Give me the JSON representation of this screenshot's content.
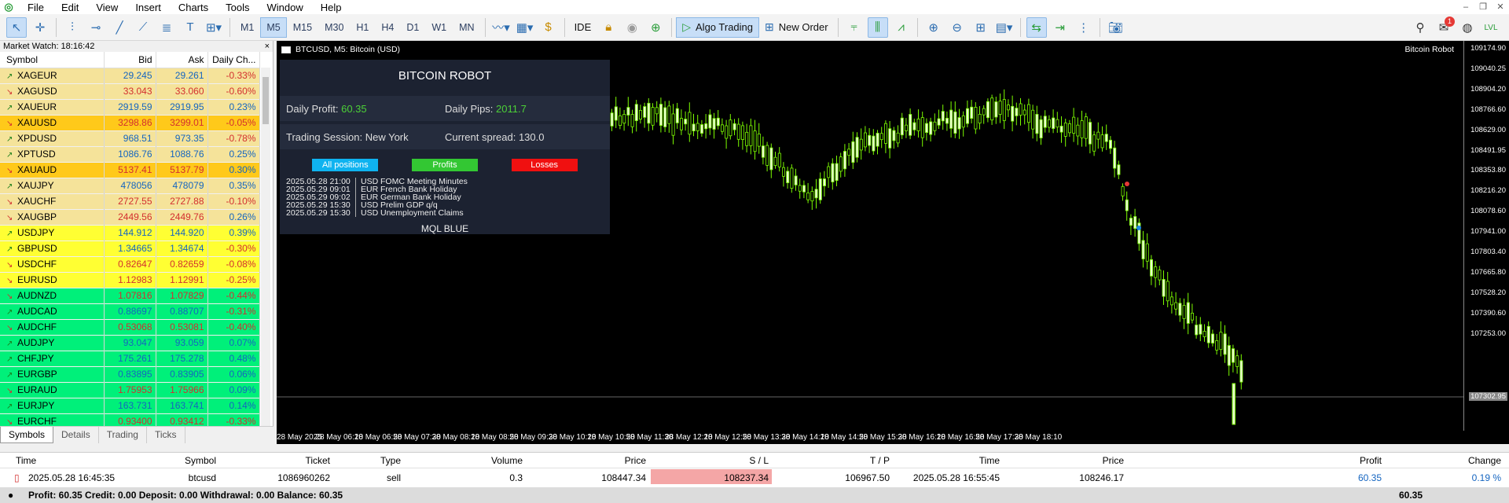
{
  "menu": [
    "File",
    "Edit",
    "View",
    "Insert",
    "Charts",
    "Tools",
    "Window",
    "Help"
  ],
  "toolbar": {
    "timeframes": [
      "M1",
      "M5",
      "M15",
      "M30",
      "H1",
      "H4",
      "D1",
      "W1",
      "MN"
    ],
    "active_tf": "M5",
    "ide": "IDE",
    "algo": "Algo Trading",
    "new_order": "New Order",
    "notif_count": "1",
    "lvl": "LVL"
  },
  "market_watch": {
    "title": "Market Watch: 18:16:42",
    "headers": [
      "Symbol",
      "Bid",
      "Ask",
      "Daily Ch..."
    ],
    "rows": [
      [
        "XAGEUR",
        "29.245",
        "29.261",
        "-0.33%",
        "up",
        "dn",
        "#f5e39a"
      ],
      [
        "XAGUSD",
        "33.043",
        "33.060",
        "-0.60%",
        "dn",
        "dn",
        "#f5e39a"
      ],
      [
        "XAUEUR",
        "2919.59",
        "2919.95",
        "0.23%",
        "up",
        "up",
        "#f5e39a"
      ],
      [
        "XAUUSD",
        "3298.86",
        "3299.01",
        "-0.05%",
        "dn",
        "dn",
        "#ffc91a"
      ],
      [
        "XPDUSD",
        "968.51",
        "973.35",
        "-0.78%",
        "up",
        "dn",
        "#f5e39a"
      ],
      [
        "XPTUSD",
        "1086.76",
        "1088.76",
        "0.25%",
        "up",
        "up",
        "#f5e39a"
      ],
      [
        "XAUAUD",
        "5137.41",
        "5137.79",
        "0.30%",
        "dn",
        "up",
        "#ffc91a"
      ],
      [
        "XAUJPY",
        "478056",
        "478079",
        "0.35%",
        "up",
        "up",
        "#f5e39a"
      ],
      [
        "XAUCHF",
        "2727.55",
        "2727.88",
        "-0.10%",
        "dn",
        "dn",
        "#f5e39a"
      ],
      [
        "XAUGBP",
        "2449.56",
        "2449.76",
        "0.26%",
        "dn",
        "up",
        "#f5e39a"
      ],
      [
        "USDJPY",
        "144.912",
        "144.920",
        "0.39%",
        "up",
        "up",
        "#ffff33"
      ],
      [
        "GBPUSD",
        "1.34665",
        "1.34674",
        "-0.30%",
        "up",
        "dn",
        "#ffff33"
      ],
      [
        "USDCHF",
        "0.82647",
        "0.82659",
        "-0.08%",
        "dn",
        "dn",
        "#ffff33"
      ],
      [
        "EURUSD",
        "1.12983",
        "1.12991",
        "-0.25%",
        "dn",
        "dn",
        "#ffff33"
      ],
      [
        "AUDNZD",
        "1.07816",
        "1.07829",
        "-0.44%",
        "dn",
        "dn",
        "#00f07a"
      ],
      [
        "AUDCAD",
        "0.88697",
        "0.88707",
        "-0.31%",
        "up",
        "dn",
        "#00f07a"
      ],
      [
        "AUDCHF",
        "0.53068",
        "0.53081",
        "-0.40%",
        "dn",
        "dn",
        "#00f07a"
      ],
      [
        "AUDJPY",
        "93.047",
        "93.059",
        "0.07%",
        "up",
        "up",
        "#00f07a"
      ],
      [
        "CHFJPY",
        "175.261",
        "175.278",
        "0.48%",
        "up",
        "up",
        "#00f07a"
      ],
      [
        "EURGBP",
        "0.83895",
        "0.83905",
        "0.06%",
        "up",
        "up",
        "#00f07a"
      ],
      [
        "EURAUD",
        "1.75953",
        "1.75966",
        "0.09%",
        "dn",
        "up",
        "#00f07a"
      ],
      [
        "EURJPY",
        "163.731",
        "163.741",
        "0.14%",
        "up",
        "up",
        "#00f07a"
      ],
      [
        "EURCHF",
        "0.93400",
        "0.93412",
        "-0.33%",
        "dn",
        "dn",
        "#00f07a"
      ]
    ],
    "tabs": [
      "Symbols",
      "Details",
      "Trading",
      "Ticks"
    ]
  },
  "chart": {
    "header": "BTCUSD, M5:  Bitcoin (USD)",
    "robot_name": "Bitcoin Robot",
    "y_labels": [
      "109174.90",
      "109040.25",
      "108904.20",
      "108766.60",
      "108629.00",
      "108491.95",
      "108353.80",
      "108216.20",
      "108078.60",
      "107941.00",
      "107803.40",
      "107665.80",
      "107528.20",
      "107390.60",
      "107253.00"
    ],
    "current_price": "107302.95",
    "x_labels": [
      "28 May 2025",
      "28 May 06:10",
      "28 May 06:50",
      "28 May 07:30",
      "28 May 08:10",
      "28 May 08:50",
      "28 May 09:30",
      "28 May 10:10",
      "28 May 10:50",
      "28 May 11:30",
      "28 May 12:10",
      "28 May 12:50",
      "28 May 13:30",
      "28 May 14:10",
      "28 May 14:50",
      "28 May 15:30",
      "28 May 16:10",
      "28 May 16:50",
      "28 May 17:30",
      "28 May 18:10"
    ]
  },
  "panel": {
    "title": "BITCOIN ROBOT",
    "daily_profit_label": "Daily Profit:",
    "daily_profit": "60.35",
    "daily_pips_label": "Daily Pips:",
    "daily_pips": "2011.7",
    "session_label": "Trading Session:",
    "session": "New York",
    "spread_label": "Current spread:",
    "spread": "130.0",
    "btn_all": "All positions",
    "btn_profits": "Profits",
    "btn_losses": "Losses",
    "news": [
      [
        "2025.05.28 21:00",
        "USD",
        "FOMC Meeting Minutes"
      ],
      [
        "2025.05.29 09:01",
        "EUR",
        "French Bank Holiday"
      ],
      [
        "2025.05.29 09:02",
        "EUR",
        "German Bank Holiday"
      ],
      [
        "2025.05.29 15:30",
        "USD",
        "Prelim GDP q/q"
      ],
      [
        "2025.05.29 15:30",
        "USD",
        "Unemployment Claims"
      ]
    ],
    "footer": "MQL BLUE"
  },
  "trade": {
    "headers": [
      "Time",
      "Symbol",
      "Ticket",
      "Type",
      "Volume",
      "Price",
      "S / L",
      "T / P",
      "Time",
      "Price",
      "Profit",
      "Change"
    ],
    "row": [
      "2025.05.28 16:45:35",
      "btcusd",
      "1086960262",
      "sell",
      "0.3",
      "108447.34",
      "108237.34",
      "106967.50",
      "2025.05.28 16:55:45",
      "108246.17",
      "60.35",
      "0.19 %"
    ],
    "balance_line": "Profit: 60.35   Credit: 0.00   Deposit: 0.00   Withdrawal: 0.00   Balance: 60.35",
    "total": "60.35"
  },
  "colors": {
    "accent": "#c7def7",
    "up": "#1565c0",
    "down": "#d32f2f",
    "candle": "#7CFC00"
  }
}
